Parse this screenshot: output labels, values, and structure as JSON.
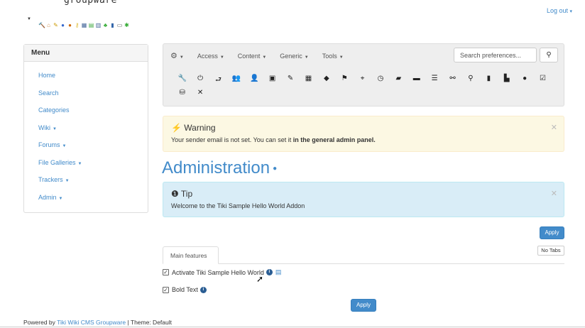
{
  "site": {
    "title": "groupware"
  },
  "header": {
    "logout_label": "Log out"
  },
  "sidebar": {
    "heading": "Menu",
    "items": [
      {
        "label": "Home",
        "has_caret": false
      },
      {
        "label": "Search",
        "has_caret": false
      },
      {
        "label": "Categories",
        "has_caret": false
      },
      {
        "label": "Wiki",
        "has_caret": true
      },
      {
        "label": "Forums",
        "has_caret": true
      },
      {
        "label": "File Galleries",
        "has_caret": true
      },
      {
        "label": "Trackers",
        "has_caret": true
      },
      {
        "label": "Admin",
        "has_caret": true
      }
    ]
  },
  "adminbar": {
    "nav": [
      "Access",
      "Content",
      "Generic",
      "Tools"
    ],
    "search_placeholder": "Search preferences...",
    "icons_row1": [
      "wrench-icon",
      "power-icon",
      "login-icon",
      "users-icon",
      "user-icon",
      "image-icon",
      "edit-icon",
      "grid-icon",
      "tag-icon",
      "flag-icon",
      "map-marker-icon",
      "clock-icon",
      "lock-icon",
      "comment-icon",
      "list-icon",
      "link-icon",
      "search-icon",
      "file-icon",
      "save-icon",
      "chat-icon",
      "checkbox-icon"
    ],
    "icons_row2": [
      "database-icon",
      "tools-icon"
    ]
  },
  "warning": {
    "title": "Warning",
    "body_prefix": "Your sender email is not set. You can set it ",
    "body_link": "in the general admin panel."
  },
  "page": {
    "title": "Administration"
  },
  "tip": {
    "title": "Tip",
    "body": "Welcome to the Tiki Sample Hello World Addon"
  },
  "buttons": {
    "apply": "Apply",
    "no_tabs": "No Tabs"
  },
  "tabs": {
    "main_features": "Main features"
  },
  "features": [
    {
      "label": "Activate Tiki Sample Hello World",
      "checked": true,
      "has_doc": true
    },
    {
      "label": "Bold Text",
      "checked": true,
      "has_doc": false
    }
  ],
  "footer": {
    "prefix": "Powered by ",
    "link": "Tiki Wiki CMS Groupware",
    "suffix": " | Theme: Default"
  },
  "colors": {
    "accent": "#428bca",
    "warning_bg": "#fcf8e3",
    "info_bg": "#d9edf7"
  }
}
